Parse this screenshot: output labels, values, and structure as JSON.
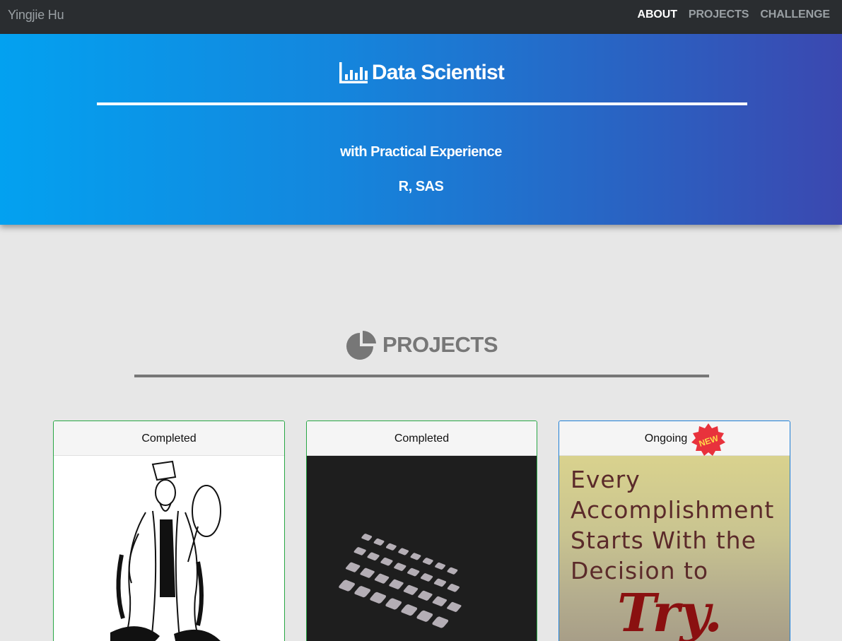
{
  "nav": {
    "brand": "Yingjie Hu",
    "links": [
      "ABOUT",
      "PROJECTS",
      "CHALLENGE"
    ],
    "active": "ABOUT"
  },
  "hero": {
    "title": "Data Scientist",
    "icon": "bar-chart-icon",
    "subtitle": "with Practical Experience",
    "skills": "R, SAS"
  },
  "projects": {
    "title": "PROJECTS",
    "icon": "pie-chart-icon",
    "cards": [
      {
        "status": "Completed",
        "image": "sage-illustration"
      },
      {
        "status": "Completed",
        "image": "keyboard-photo"
      },
      {
        "status": "Ongoing",
        "badge": "NEW",
        "image": "motivational-quote",
        "quote": [
          "Every",
          "Accomplishment",
          "Starts With the",
          "Decision to"
        ],
        "quote_emphasis": "Try."
      }
    ]
  },
  "colors": {
    "navbar": "#2a2d30",
    "hero_gradient_start": "#03a1f0",
    "hero_gradient_end": "#3b48b0",
    "completed_border": "#28a745",
    "ongoing_border": "#1f7fd6",
    "badge": "#e8323c"
  }
}
